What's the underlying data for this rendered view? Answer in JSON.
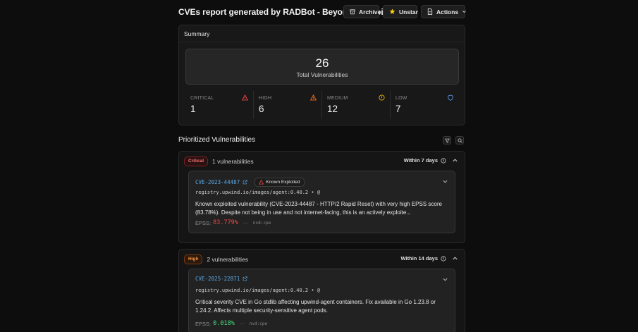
{
  "header": {
    "title": "CVEs report generated by RADBot - Beyond the Noise",
    "buttons": {
      "archive": "Archive",
      "unstar": "Unstar",
      "actions": "Actions"
    }
  },
  "summary": {
    "title": "Summary",
    "total": "26",
    "total_label": "Total Vulnerabilities",
    "severities": [
      {
        "label": "CRITICAL",
        "value": "1",
        "color": "#ef4444",
        "icon": "warning-triangle-icon"
      },
      {
        "label": "HIGH",
        "value": "6",
        "color": "#f97316",
        "icon": "warning-triangle-icon"
      },
      {
        "label": "MEDIUM",
        "value": "12",
        "color": "#eab308",
        "icon": "alert-circle-icon"
      },
      {
        "label": "LOW",
        "value": "7",
        "color": "#60a5fa",
        "icon": "shield-icon"
      }
    ]
  },
  "prioritized": {
    "title": "Prioritized Vulnerabilities",
    "groups": [
      {
        "badge": "Critical",
        "count": "1 vulnerabilities",
        "within": "Within 7 days",
        "item": {
          "cve": "CVE-2023-44487",
          "tag": "Known Exploited",
          "registry": "registry.upwind.io/images/agent:0.40.2 • @",
          "description": "Known exploited vulnerability (CVE-2023-44487 - HTTP/2 Rapid Reset) with very high EPSS score (83.78%). Despite not being in use and not internet-facing, this is an actively exploite...",
          "epss_label": "EPSS:",
          "epss_value": "83.779%",
          "epss_color": "#ef4444",
          "source": "nvd:cpe"
        }
      },
      {
        "badge": "High",
        "count": "2 vulnerabilities",
        "within": "Within 14 days",
        "item": {
          "cve": "CVE-2025-22871",
          "registry": "registry.upwind.io/images/agent:0.40.2 • @",
          "description": "Critical severity CVE in Go stdlib affecting upwind-agent containers. Fix available in Go 1.23.8 or 1.24.2. Affects multiple security-sensitive agent pods.",
          "epss_label": "EPSS:",
          "epss_value": "0.018%",
          "epss_color": "#4ade80",
          "source": "nvd:cpe"
        }
      }
    ]
  }
}
